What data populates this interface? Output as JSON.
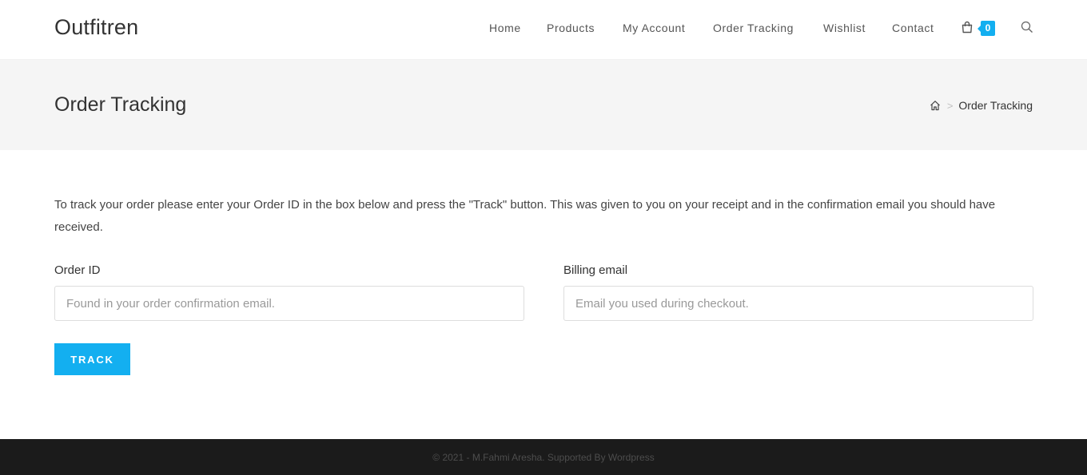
{
  "header": {
    "logo": "Outfitren",
    "nav": [
      {
        "label": "Home"
      },
      {
        "label": "Products"
      },
      {
        "label": "My Account"
      },
      {
        "label": "Order Tracking"
      },
      {
        "label": "Wishlist"
      },
      {
        "label": "Contact"
      }
    ],
    "cart": {
      "icon": "shopping-bag-icon",
      "count": "0"
    },
    "search": {
      "icon": "search-icon"
    }
  },
  "page_header": {
    "title": "Order Tracking",
    "breadcrumb": {
      "home_icon": "home-icon",
      "separator": ">",
      "current": "Order Tracking"
    }
  },
  "content": {
    "intro": "To track your order please enter your Order ID in the box below and press the \"Track\" button. This was given to you on your receipt and in the confirmation email you should have received.",
    "order_id": {
      "label": "Order ID",
      "value": "",
      "placeholder": "Found in your order confirmation email."
    },
    "billing_email": {
      "label": "Billing email",
      "value": "",
      "placeholder": "Email you used during checkout."
    },
    "track_button": "TRACK"
  },
  "footer": {
    "copyright": "© 2021 - M.Fahmi Aresha. Supported By Wordpress"
  },
  "colors": {
    "accent": "#13aff0",
    "page_header_bg": "#f5f5f5",
    "footer_bg": "#1b1b1b"
  }
}
